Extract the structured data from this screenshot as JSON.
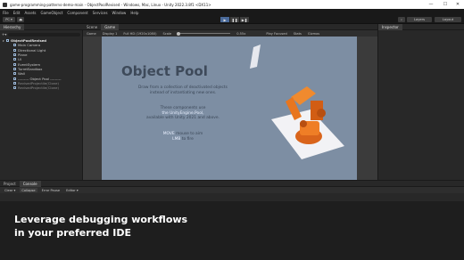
{
  "window": {
    "title": "game-programming-patterns-demo-main - ObjectPoolRevised - Windows, Mac, Linux - Unity 2022.3.8f1 <DX11>",
    "controls": [
      "—",
      "☐",
      "✕"
    ]
  },
  "menu": [
    "File",
    "Edit",
    "Assets",
    "GameObject",
    "Component",
    "Services",
    "Window",
    "Help"
  ],
  "toolbar": {
    "account": "PC ▾",
    "cloud_icon": "cloud-icon",
    "layers": "Layers",
    "layout": "Layout",
    "play": "▶",
    "pause": "❚❚",
    "step": "▶❚"
  },
  "hierarchy": {
    "tab": "Hierarchy",
    "items": [
      {
        "label": "ObjectPoolRevised",
        "indent": 0,
        "style": "root"
      },
      {
        "label": "Main Camera",
        "indent": 2,
        "style": "normal"
      },
      {
        "label": "Directional Light",
        "indent": 2,
        "style": "normal"
      },
      {
        "label": "Plane",
        "indent": 2,
        "style": "normal"
      },
      {
        "label": "UI",
        "indent": 2,
        "style": "normal"
      },
      {
        "label": "EventSystem",
        "indent": 2,
        "style": "normal"
      },
      {
        "label": "TurretSandbox",
        "indent": 2,
        "style": "normal"
      },
      {
        "label": "Wall",
        "indent": 2,
        "style": "normal"
      },
      {
        "label": "--------- Object Pool ---------",
        "indent": 2,
        "style": "normal"
      },
      {
        "label": "RevisedProjectile(Clone)",
        "indent": 2,
        "style": "dim"
      },
      {
        "label": "RevisedProjectile(Clone)",
        "indent": 2,
        "style": "dim"
      }
    ]
  },
  "scene": {
    "tabs": [
      "Scene",
      "Game"
    ],
    "active_tab": "Game",
    "game_bar": {
      "mode": "Game",
      "display": "Display 1",
      "resolution": "Full HD (1920x1080)",
      "scale_label": "Scale",
      "scale_value": "0.55x",
      "play_focused": "Play Focused",
      "stats": "Stats",
      "gizmos": "Gizmos"
    }
  },
  "game": {
    "title": "Object Pool",
    "paragraph1": "Draw from a collection of deactivated objects instead of instantiating new ones.",
    "paragraph2_pre": "These components use",
    "paragraph2_hl1": "the UnityEngine.Pool,",
    "paragraph2_post": "available with Unity 2021 and above.",
    "move_hl": "MOVE",
    "move_text": "mouse to aim",
    "lmb_hl": "LMB",
    "lmb_text": "to fire"
  },
  "inspector": {
    "tab": "Inspector"
  },
  "bottom": {
    "tabs": [
      "Project",
      "Console"
    ],
    "active_tab": "Console",
    "console_bar": [
      "Clear ▾",
      "Collapse",
      "Error Pause",
      "Editor ▾"
    ]
  },
  "caption": {
    "line1": "Leverage debugging workflows",
    "line2": " in your preferred IDE"
  },
  "colors": {
    "game_bg": "#7d8ea3",
    "turret": "#e8761f",
    "editor_bg": "#282828"
  }
}
